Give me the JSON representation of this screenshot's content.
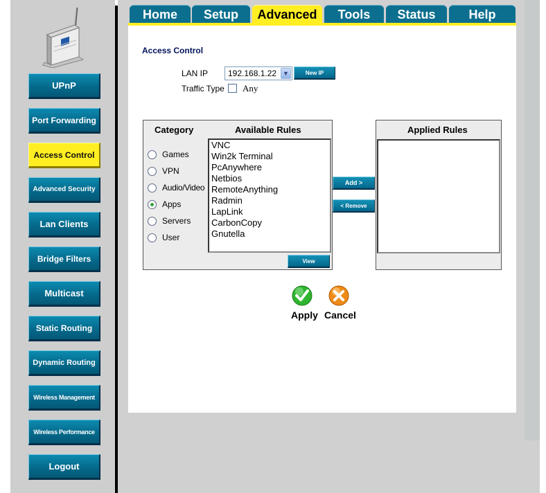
{
  "tabs": [
    {
      "label": "Home"
    },
    {
      "label": "Setup"
    },
    {
      "label": "Advanced"
    },
    {
      "label": "Tools"
    },
    {
      "label": "Status"
    },
    {
      "label": "Help"
    }
  ],
  "sidebar": {
    "items": [
      {
        "label": "UPnP"
      },
      {
        "label": "Port Forwarding"
      },
      {
        "label": "Access Control"
      },
      {
        "label": "Advanced Security"
      },
      {
        "label": "Lan Clients"
      },
      {
        "label": "Bridge Filters"
      },
      {
        "label": "Multicast"
      },
      {
        "label": "Static Routing"
      },
      {
        "label": "Dynamic Routing"
      },
      {
        "label": "Wireless Management"
      },
      {
        "label": "Wireless Performance"
      },
      {
        "label": "Logout"
      }
    ]
  },
  "main": {
    "title": "Access Control",
    "lan_ip_label": "LAN IP",
    "lan_ip_value": "192.168.1.22",
    "new_ip_button": "New IP",
    "traffic_type_label": "Traffic Type",
    "traffic_any_label": "Any",
    "category_header": "Category",
    "available_header": "Available Rules",
    "applied_header": "Applied Rules",
    "categories": [
      {
        "label": "Games",
        "selected": false
      },
      {
        "label": "VPN",
        "selected": false
      },
      {
        "label": "Audio/Video",
        "selected": false
      },
      {
        "label": "Apps",
        "selected": true
      },
      {
        "label": "Servers",
        "selected": false
      },
      {
        "label": "User",
        "selected": false
      }
    ],
    "available_rules": [
      "VNC",
      "Win2k Terminal",
      "PcAnywhere",
      "Netbios",
      "RemoteAnything",
      "Radmin",
      "LapLink",
      "CarbonCopy",
      "Gnutella"
    ],
    "add_button": "Add >",
    "remove_button": "< Remove",
    "view_button": "View",
    "apply_label": "Apply",
    "cancel_label": "Cancel"
  },
  "colors": {
    "tab_blue": "#0c6f8f",
    "accent_yellow": "#ffee22",
    "title_navy": "#00135a",
    "apply_green": "#2fb52f",
    "cancel_orange": "#ee8a18"
  },
  "icons": {
    "device": "router-device-icon",
    "apply": "checkmark-icon",
    "cancel": "cross-icon",
    "dropdown": "chevron-down-icon"
  }
}
